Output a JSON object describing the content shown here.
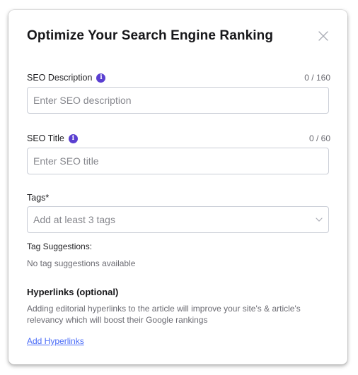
{
  "modal": {
    "title": "Optimize Your Search Engine Ranking",
    "close_icon": "close-icon"
  },
  "seo_description": {
    "label": "SEO Description",
    "counter": "0 / 160",
    "placeholder": "Enter SEO description",
    "value": ""
  },
  "seo_title": {
    "label": "SEO Title",
    "counter": "0 / 60",
    "placeholder": "Enter SEO title",
    "value": ""
  },
  "tags": {
    "label": "Tags*",
    "placeholder": "Add at least 3 tags",
    "icon": "chevron-down-icon"
  },
  "tag_suggestions": {
    "heading": "Tag Suggestions:",
    "empty_text": "No tag suggestions available"
  },
  "hyperlinks": {
    "heading": "Hyperlinks (optional)",
    "description": "Adding editorial hyperlinks to the article will improve your site's & article's relevancy which will boost their Google rankings",
    "link_label": "Add Hyperlinks"
  },
  "colors": {
    "info_badge": "#5a3fd1",
    "link": "#4a6cf7",
    "border": "#c9cdd6"
  }
}
